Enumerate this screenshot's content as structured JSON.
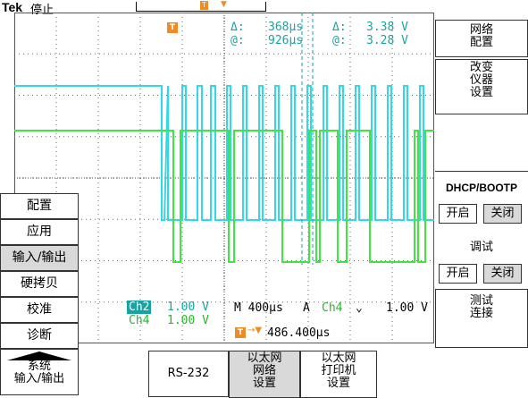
{
  "status": {
    "brand": "Tek",
    "run_state": "停止"
  },
  "record": {
    "trigger_marker": "T"
  },
  "cursors": {
    "delta_label": "Δ:",
    "delta_time": "368µs",
    "at_label": "@:",
    "at_time": "926µs",
    "delta_v_label": "Δ:",
    "delta_volt": "3.38 V",
    "at_v_label": "@:",
    "at_volt": "3.28 V"
  },
  "channels": [
    {
      "name": "Ch2",
      "scale": "1.00 V",
      "color": "#17a3a3"
    },
    {
      "name": "Ch4",
      "scale": "1.00 V",
      "color": "#2bb52b"
    }
  ],
  "timebase": {
    "label": "M 400µs",
    "source_prefix": "A",
    "source": "Ch4",
    "slope": "⌄",
    "level": "1.00 V"
  },
  "trigger_pos": {
    "icon": "T",
    "value": "486.400µs"
  },
  "right_menu": {
    "network_config": "网络\n配置",
    "change_instrument": "改变\n仪器\n设置",
    "dhcp_title": "DHCP/BOOTP",
    "dhcp_on": "开启",
    "dhcp_off": "关闭",
    "debug_title": "调试",
    "debug_on": "开启",
    "debug_off": "关闭",
    "test_connection": "测试\n连接"
  },
  "left_menu": {
    "items": [
      "配置",
      "应用",
      "输入/输出",
      "硬拷贝",
      "校准",
      "诊断"
    ],
    "system": "系统\n输入/输出"
  },
  "bottom_menu": {
    "rs232": "RS-232",
    "ethernet_network": "以太网\n网络\n设置",
    "ethernet_printer": "以太网\n打印机\n设置"
  },
  "colors": {
    "ch_cyan": "#2fd9e8",
    "ch_green": "#3ee63e",
    "accent": "#f08a24"
  }
}
